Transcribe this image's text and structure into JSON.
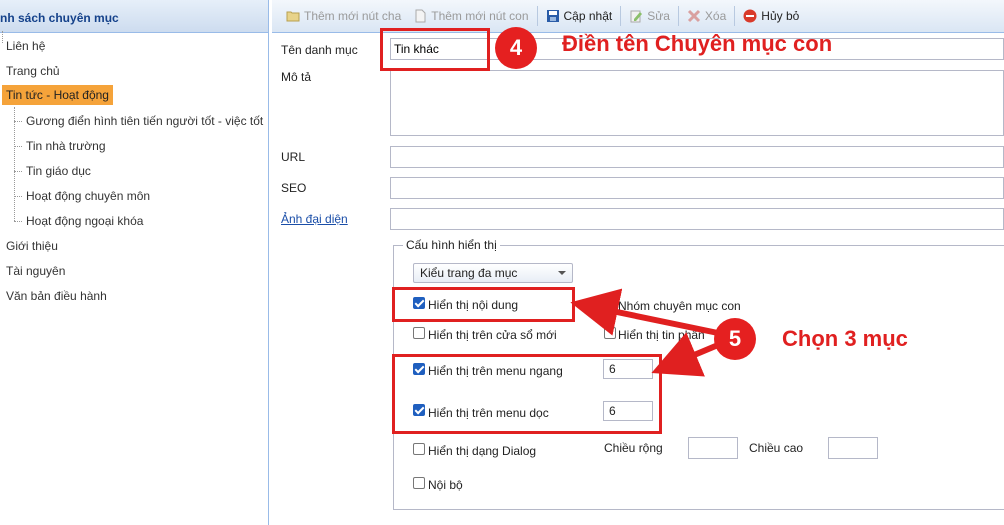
{
  "left_panel": {
    "header": "nh sách chuyên mục",
    "items": [
      {
        "label": "Liên hệ"
      },
      {
        "label": "Trang chủ"
      },
      {
        "label": "Tin tức - Hoạt động",
        "selected": true
      },
      {
        "label": "Gương điển hình tiên tiến người tốt - việc tốt"
      },
      {
        "label": "Tin nhà trường"
      },
      {
        "label": "Tin giáo dục"
      },
      {
        "label": "Hoạt động chuyên môn"
      },
      {
        "label": "Hoạt động ngoại khóa"
      },
      {
        "label": "Giới thiệu"
      },
      {
        "label": "Tài nguyên"
      },
      {
        "label": "Văn bản điều hành"
      }
    ]
  },
  "toolbar": {
    "add_parent": "Thêm mới nút cha",
    "add_child": "Thêm mới nút con",
    "update": "Cập nhật",
    "edit": "Sửa",
    "delete": "Xóa",
    "cancel": "Hủy bỏ"
  },
  "form": {
    "name_label": "Tên danh mục",
    "name_value": "Tin khác",
    "desc_label": "Mô tả",
    "url_label": "URL",
    "seo_label": "SEO",
    "image_label": "Ảnh đại diện",
    "display_config_legend": "Cấu hình hiển thị",
    "page_type": "Kiểu trang đa mục",
    "options": {
      "show_content": "Hiển thị nội dung",
      "child_group": "Nhóm chuyên mục con",
      "new_window": "Hiển thị trên cửa sổ mới",
      "show_news": "Hiển thị tin phân",
      "horizontal_menu": "Hiển thị trên menu ngang",
      "horizontal_menu_value": "6",
      "vertical_menu": "Hiển thị trên menu dọc",
      "vertical_menu_value": "6",
      "dialog": "Hiển thị dạng Dialog",
      "width_label": "Chiều rộng",
      "height_label": "Chiều cao",
      "internal": "Nội bộ"
    }
  },
  "annotations": {
    "step4_number": "4",
    "step4_text": "Điền tên Chuyên mục con",
    "step5_number": "5",
    "step5_text": "Chọn 3 mục",
    "color": "#e02020"
  }
}
